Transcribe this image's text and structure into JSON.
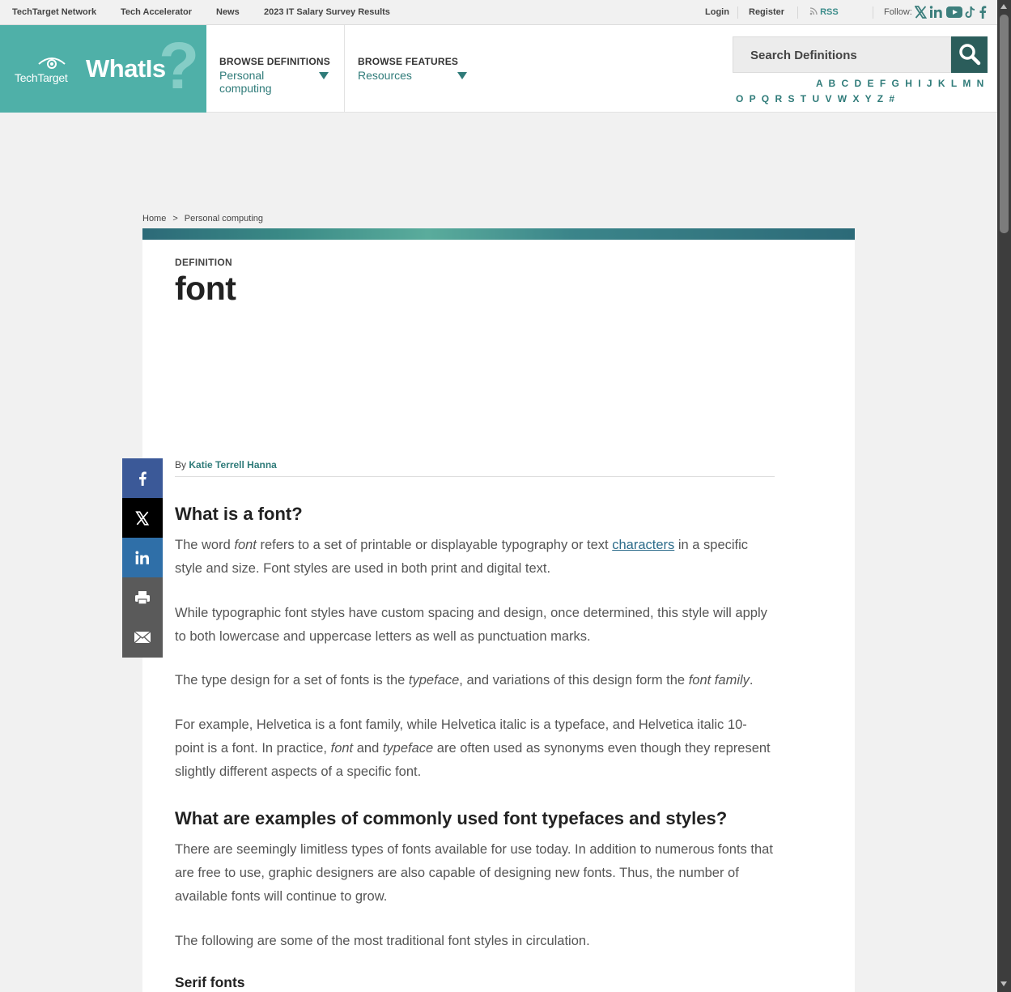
{
  "topbar": {
    "links": [
      "TechTarget Network",
      "Tech Accelerator",
      "News",
      "2023 IT Salary Survey Results"
    ],
    "login": "Login",
    "register": "Register",
    "rss": "RSS",
    "follow": "Follow:"
  },
  "header": {
    "logo_brand": "TechTarget",
    "logo_title": "WhatIs",
    "browse_definitions": {
      "heading": "BROWSE DEFINITIONS",
      "selected": "Personal computing"
    },
    "browse_features": {
      "heading": "BROWSE FEATURES",
      "selected": "Resources"
    },
    "search_placeholder": "Search Definitions",
    "alphabet_row1": "A B C D E F G H I J K L M N",
    "alphabet_row2": "O P Q R S T U V W X Y Z #"
  },
  "breadcrumb": {
    "home": "Home",
    "separator": ">",
    "current": "Personal computing"
  },
  "article": {
    "kicker": "DEFINITION",
    "title": "font",
    "byline_prefix": "By",
    "author": "Katie Terrell Hanna",
    "h2_what": "What is a font?",
    "p1_a": "The word ",
    "p1_em": "font",
    "p1_b": " refers to a set of printable or displayable typography or text ",
    "p1_link": "characters",
    "p1_c": " in a specific style and size. Font styles are used in both print and digital text.",
    "p2": "While typographic font styles have custom spacing and design, once determined, this style will apply to both lowercase and uppercase letters as well as punctuation marks.",
    "p3_a": "The type design for a set of fonts is the ",
    "p3_em1": "typeface",
    "p3_b": ", and variations of this design form the ",
    "p3_em2": "font family",
    "p3_c": ".",
    "p4_a": "For example, Helvetica is a font family, while Helvetica italic is a typeface, and Helvetica italic 10-point is a font. In practice, ",
    "p4_em1": "font",
    "p4_b": " and ",
    "p4_em2": "typeface",
    "p4_c": " are often used as synonyms even though they represent slightly different aspects of a specific font.",
    "h2_examples": "What are examples of commonly used font typefaces and styles?",
    "p5": "There are seemingly limitless types of fonts available for use today. In addition to numerous fonts that are free to use, graphic designers are also capable of designing new fonts. Thus, the number of available fonts will continue to grow.",
    "p6": "The following are some of the most traditional font styles in circulation.",
    "h3_serif": "Serif fonts"
  },
  "colors": {
    "brand_teal": "#4fb0a8",
    "dark_teal": "#2b5d5b",
    "link_teal": "#2f7b79",
    "facebook": "#3b5998",
    "x": "#000000",
    "linkedin": "#2f6fa8",
    "print": "#5a5a5a",
    "email": "#5a5a5a"
  },
  "icons": [
    "eye-logo-icon",
    "search-icon",
    "rss-icon",
    "x-icon",
    "linkedin-icon",
    "youtube-icon",
    "tiktok-icon",
    "facebook-icon",
    "chevron-down-icon",
    "print-icon",
    "email-icon"
  ]
}
